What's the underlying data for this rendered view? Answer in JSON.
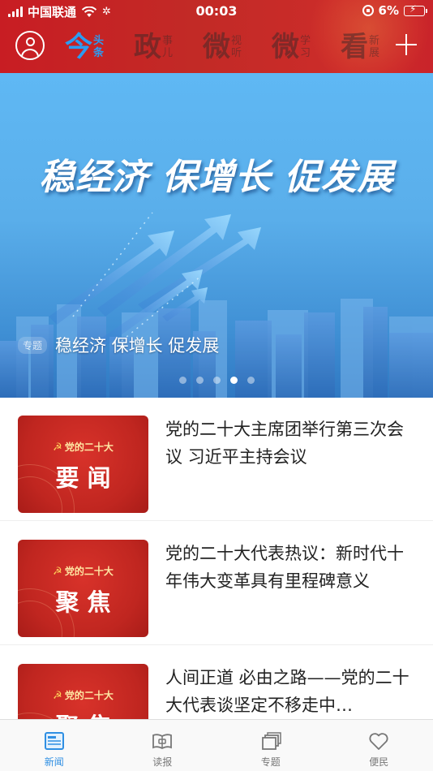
{
  "status_bar": {
    "carrier": "中国联通",
    "time": "00:03",
    "battery": "6%"
  },
  "channels": [
    {
      "big": "今",
      "small_top": "头",
      "small_bottom": "条",
      "active": true
    },
    {
      "big": "政",
      "small_top": "事",
      "small_bottom": "儿",
      "active": false
    },
    {
      "big": "微",
      "small_top": "视",
      "small_bottom": "听",
      "active": false
    },
    {
      "big": "微",
      "small_top": "学",
      "small_bottom": "习",
      "active": false
    },
    {
      "big": "看",
      "small_top": "新",
      "small_bottom": "展",
      "active": false
    }
  ],
  "banner": {
    "headline": "稳经济 保增长 促发展",
    "tag": "专题",
    "caption": "稳经济 保增长 促发展",
    "slide_count": 5,
    "active_slide": 4
  },
  "news": [
    {
      "thumb_party": "党的二十大",
      "thumb_label": "要闻",
      "title": "党的二十大主席团举行第三次会议 习近平主持会议"
    },
    {
      "thumb_party": "党的二十大",
      "thumb_label": "聚焦",
      "title": "党的二十大代表热议：新时代十年伟大变革具有里程碑意义"
    },
    {
      "thumb_party": "党的二十大",
      "thumb_label": "聚焦",
      "title": "人间正道 必由之路——党的二十大代表谈坚定不移走中…"
    }
  ],
  "tabs": [
    {
      "label": "新闻",
      "icon": "news-icon",
      "active": true
    },
    {
      "label": "读报",
      "icon": "newspaper-icon",
      "active": false
    },
    {
      "label": "专题",
      "icon": "stack-icon",
      "active": false
    },
    {
      "label": "便民",
      "icon": "heart-icon",
      "active": false
    }
  ],
  "colors": {
    "header_red": "#c81d23",
    "active_blue": "#2b9cf2",
    "thumb_red": "#c02620",
    "tab_active": "#2f8fe3"
  }
}
